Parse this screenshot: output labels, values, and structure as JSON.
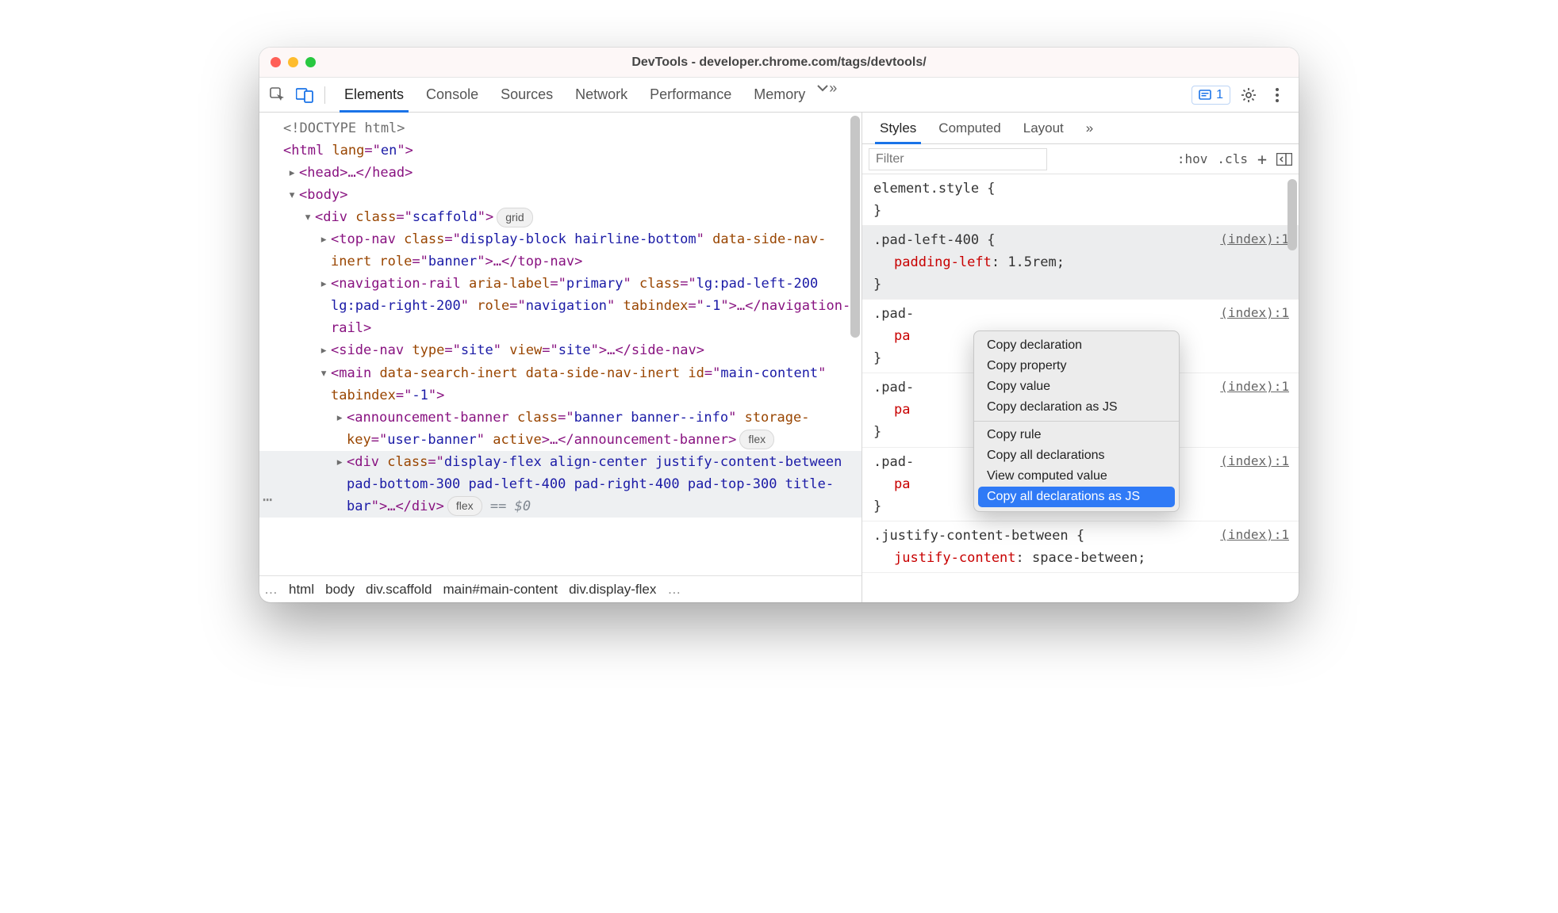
{
  "window_title": "DevTools - developer.chrome.com/tags/devtools/",
  "issues_count": "1",
  "main_tabs": [
    "Elements",
    "Console",
    "Sources",
    "Network",
    "Performance",
    "Memory"
  ],
  "sub_tabs": [
    "Styles",
    "Computed",
    "Layout"
  ],
  "filter_placeholder": "Filter",
  "filter_right": {
    "hov": ":hov",
    "cls": ".cls",
    "plus": "+"
  },
  "breadcrumb": [
    "html",
    "body",
    "div.scaffold",
    "main#main-content",
    "div.display-flex"
  ],
  "dom": {
    "l0": "<!DOCTYPE html>",
    "l1_open": "<",
    "l1_tag": "html",
    "l1_attr": " lang",
    "l1_val": "en",
    "l1_close": ">",
    "l2_open": "<",
    "l2_tag": "head",
    "l2_mid": ">…</",
    "l2_tag2": "head",
    "l2_end": ">",
    "l3_open": "<",
    "l3_tag": "body",
    "l3_end": ">",
    "l4_open": "<",
    "l4_tag": "div",
    "l4_attr": " class",
    "l4_val": "scaffold",
    "l4_end": ">",
    "l4_pill": "grid",
    "l5a": "<",
    "l5tag": "top-nav",
    "l5_attr1": " class",
    "l5_val1": "display-block hairline-bottom",
    "l5_attr2": " data-side-nav-inert",
    "l5_attr3": " role",
    "l5_val3": "banner",
    "l5_end": ">…</",
    "l5tag2": "top-nav",
    "l5e": ">",
    "l6a": "<",
    "l6tag": "navigation-rail",
    "l6_attr1": " aria-label",
    "l6_val1": "primary",
    "l6_attr2": " class",
    "l6_val2": "lg:pad-left-200 lg:pad-right-200",
    "l6_attr3": " role",
    "l6_val3": "navigation",
    "l6_attr4": " tabindex",
    "l6_val4": "-1",
    "l6_end": ">…</",
    "l6tag2": "navigation-rail",
    "l6e": ">",
    "l7a": "<",
    "l7tag": "side-nav",
    "l7_attr1": " type",
    "l7_val1": "site",
    "l7_attr2": " view",
    "l7_val2": "site",
    "l7_end": ">…</",
    "l7tag2": "side-nav",
    "l7e": ">",
    "l8a": "<",
    "l8tag": "main",
    "l8_attr1": " data-search-inert",
    "l8_attr2": " data-side-nav-inert",
    "l8_attr3": " id",
    "l8_val3": "main-content",
    "l8_attr4": " tabindex",
    "l8_val4": "-1",
    "l8e": ">",
    "l9a": "<",
    "l9tag": "announcement-banner",
    "l9_attr1": " class",
    "l9_val1": "banner banner--info",
    "l9_attr2": " storage-key",
    "l9_val2": "user-banner",
    "l9_attr3": " active",
    "l9_end": ">…</",
    "l9tag2": "announcement-banner",
    "l9e": ">",
    "l9_pill": "flex",
    "l10a": "<",
    "l10tag": "div",
    "l10_attr": " class",
    "l10_val": "display-flex align-center justify-content-between pad-bottom-300 pad-left-400 pad-right-400 pad-top-300 title-bar",
    "l10_end": ">…</",
    "l10tag2": "div",
    "l10e": ">",
    "l10_pill": "flex",
    "l10_match": " == $0"
  },
  "styles": {
    "r0_sel": "element.style {",
    "r0_end": "}",
    "r1_sel": ".pad-left-400 {",
    "r1_src": "(index):1",
    "r1_prop": "padding-left",
    "r1_val": "1.5rem;",
    "r1_end": "}",
    "r2_sel": ".pad-",
    "r2_src": "(index):1",
    "r2_prop": "pa",
    "r2_end": "}",
    "r3_sel": ".pad-",
    "r3_src": "(index):1",
    "r3_prop": "pa",
    "r3_end": "}",
    "r4_sel": ".pad-",
    "r4_src": "(index):1",
    "r4_prop": "pa",
    "r4_end": "}",
    "r5_sel": ".justify-content-between {",
    "r5_src": "(index):1",
    "r5_prop": "justify-content",
    "r5_val": "space-between;"
  },
  "ctx": {
    "i0": "Copy declaration",
    "i1": "Copy property",
    "i2": "Copy value",
    "i3": "Copy declaration as JS",
    "i4": "Copy rule",
    "i5": "Copy all declarations",
    "i6": "View computed value",
    "i7": "Copy all declarations as JS"
  }
}
